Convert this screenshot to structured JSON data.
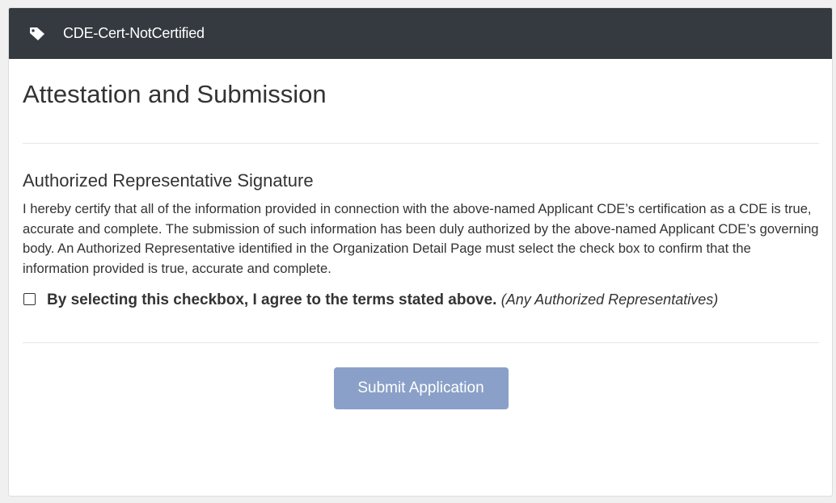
{
  "header": {
    "icon": "tag-icon",
    "title": "CDE-Cert-NotCertified"
  },
  "main": {
    "title": "Attestation and Submission",
    "section_title": "Authorized Representative Signature",
    "body_text": "I hereby certify that all of the information provided in connection with the above-named Applicant CDE’s certification as a CDE is true, accurate and complete. The submission of such information has been duly authorized by the above-named Applicant CDE’s governing body. An Authorized Representative identified in the Organization Detail Page must select the check box to confirm that the information provided is true, accurate and complete.",
    "agreement": {
      "checked": false,
      "label": "By selecting this checkbox, I agree to the terms stated above.",
      "note": "(Any Authorized Representatives)"
    },
    "submit_label": "Submit Application"
  },
  "colors": {
    "header_bg": "#343a40",
    "submit_bg": "#8aa0c8",
    "text": "#333333"
  }
}
